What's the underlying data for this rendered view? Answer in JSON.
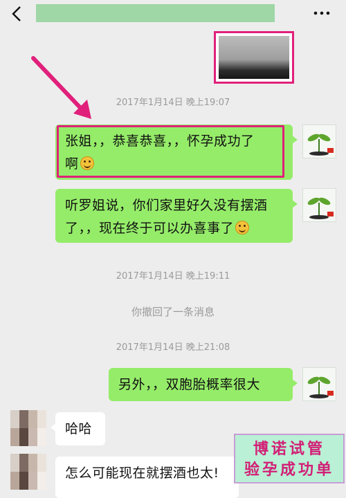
{
  "messages": {
    "ts1": "2017年1月14日 晚上19:07",
    "msg1_line1": "张姐，，恭喜恭喜，，怀孕成功了",
    "msg1_line2": "啊",
    "msg2_line1": "听罗姐说，你们家里好久没有摆酒",
    "msg2_line2": "了，，现在终于可以办喜事了",
    "ts2": "2017年1月14日 晚上19:11",
    "recall": "你撤回了一条消息",
    "ts3": "2017年1月14日 晚上21:08",
    "msg3": "另外，，双胞胎概率很大",
    "msg4": "哈哈",
    "msg5": "怎么可能现在就摆酒也太!"
  },
  "stamp": {
    "line1": "博诺试管",
    "line2": "验孕成功单"
  },
  "icons": [
    "back-icon",
    "more-icon",
    "smile-emoji",
    "laugh-emoji"
  ],
  "colors": {
    "outgoing_bubble": "#95ec69",
    "highlight": "#e0207b"
  }
}
